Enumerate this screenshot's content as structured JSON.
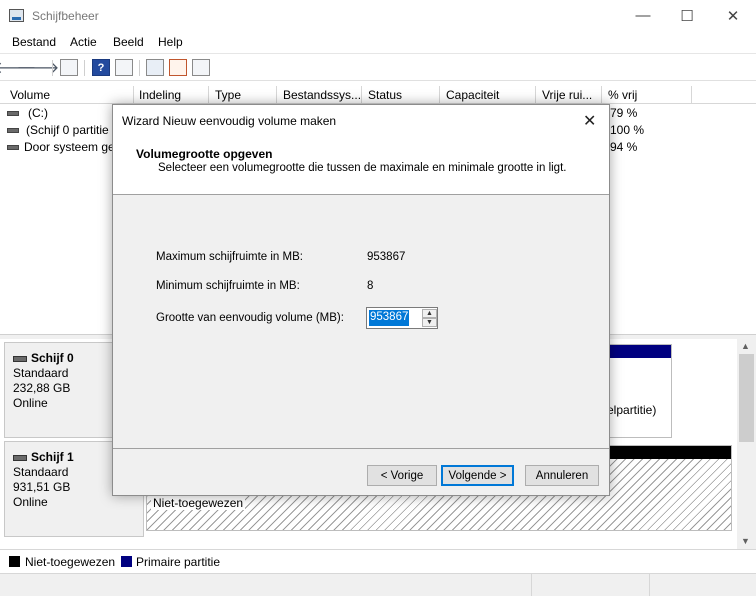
{
  "window": {
    "title": "Schijfbeheer",
    "minimize": "—",
    "maximize": "☐",
    "close": "✕"
  },
  "menu": [
    "Bestand",
    "Actie",
    "Beeld",
    "Help"
  ],
  "toolbar": {
    "back": "🡐",
    "forward": "🡒",
    "help": "?"
  },
  "table": {
    "columns": [
      "Volume",
      "Indeling",
      "Type",
      "Bestandssys...",
      "Status",
      "Capaciteit",
      "Vrije rui...",
      "% vrij"
    ],
    "rows": [
      {
        "volume": "(C:)",
        "pct": "79 %"
      },
      {
        "volume": "(Schijf 0 partitie 3",
        "pct": "100 %"
      },
      {
        "volume": "Door systeem ge",
        "pct": "94 %"
      }
    ]
  },
  "disks": [
    {
      "name": "Schijf 0",
      "type": "Standaard",
      "size": "232,88 GB",
      "state": "Online",
      "partition_text": "elpartitie)"
    },
    {
      "name": "Schijf 1",
      "type": "Standaard",
      "size": "931,51 GB",
      "state": "Online",
      "partition_text": "Niet-toegewezen"
    }
  ],
  "legend": [
    {
      "label": "Niet-toegewezen",
      "color": "#000000"
    },
    {
      "label": "Primaire partitie",
      "color": "#000080"
    }
  ],
  "dialog": {
    "title": "Wizard Nieuw eenvoudig volume maken",
    "close": "✕",
    "heading": "Volumegrootte opgeven",
    "subheading": "Selecteer een volumegrootte die tussen de maximale en minimale grootte in ligt.",
    "max_label": "Maximum schijfruimte in MB:",
    "max_value": "953867",
    "min_label": "Minimum schijfruimte in MB:",
    "min_value": "8",
    "size_label": "Grootte van eenvoudig volume (MB):",
    "size_value": "953867",
    "back_label": "< Vorige",
    "next_label": "Volgende >",
    "cancel_label": "Annuleren"
  },
  "colors": {
    "accent": "#0078d7",
    "primary_partition": "#000080"
  }
}
